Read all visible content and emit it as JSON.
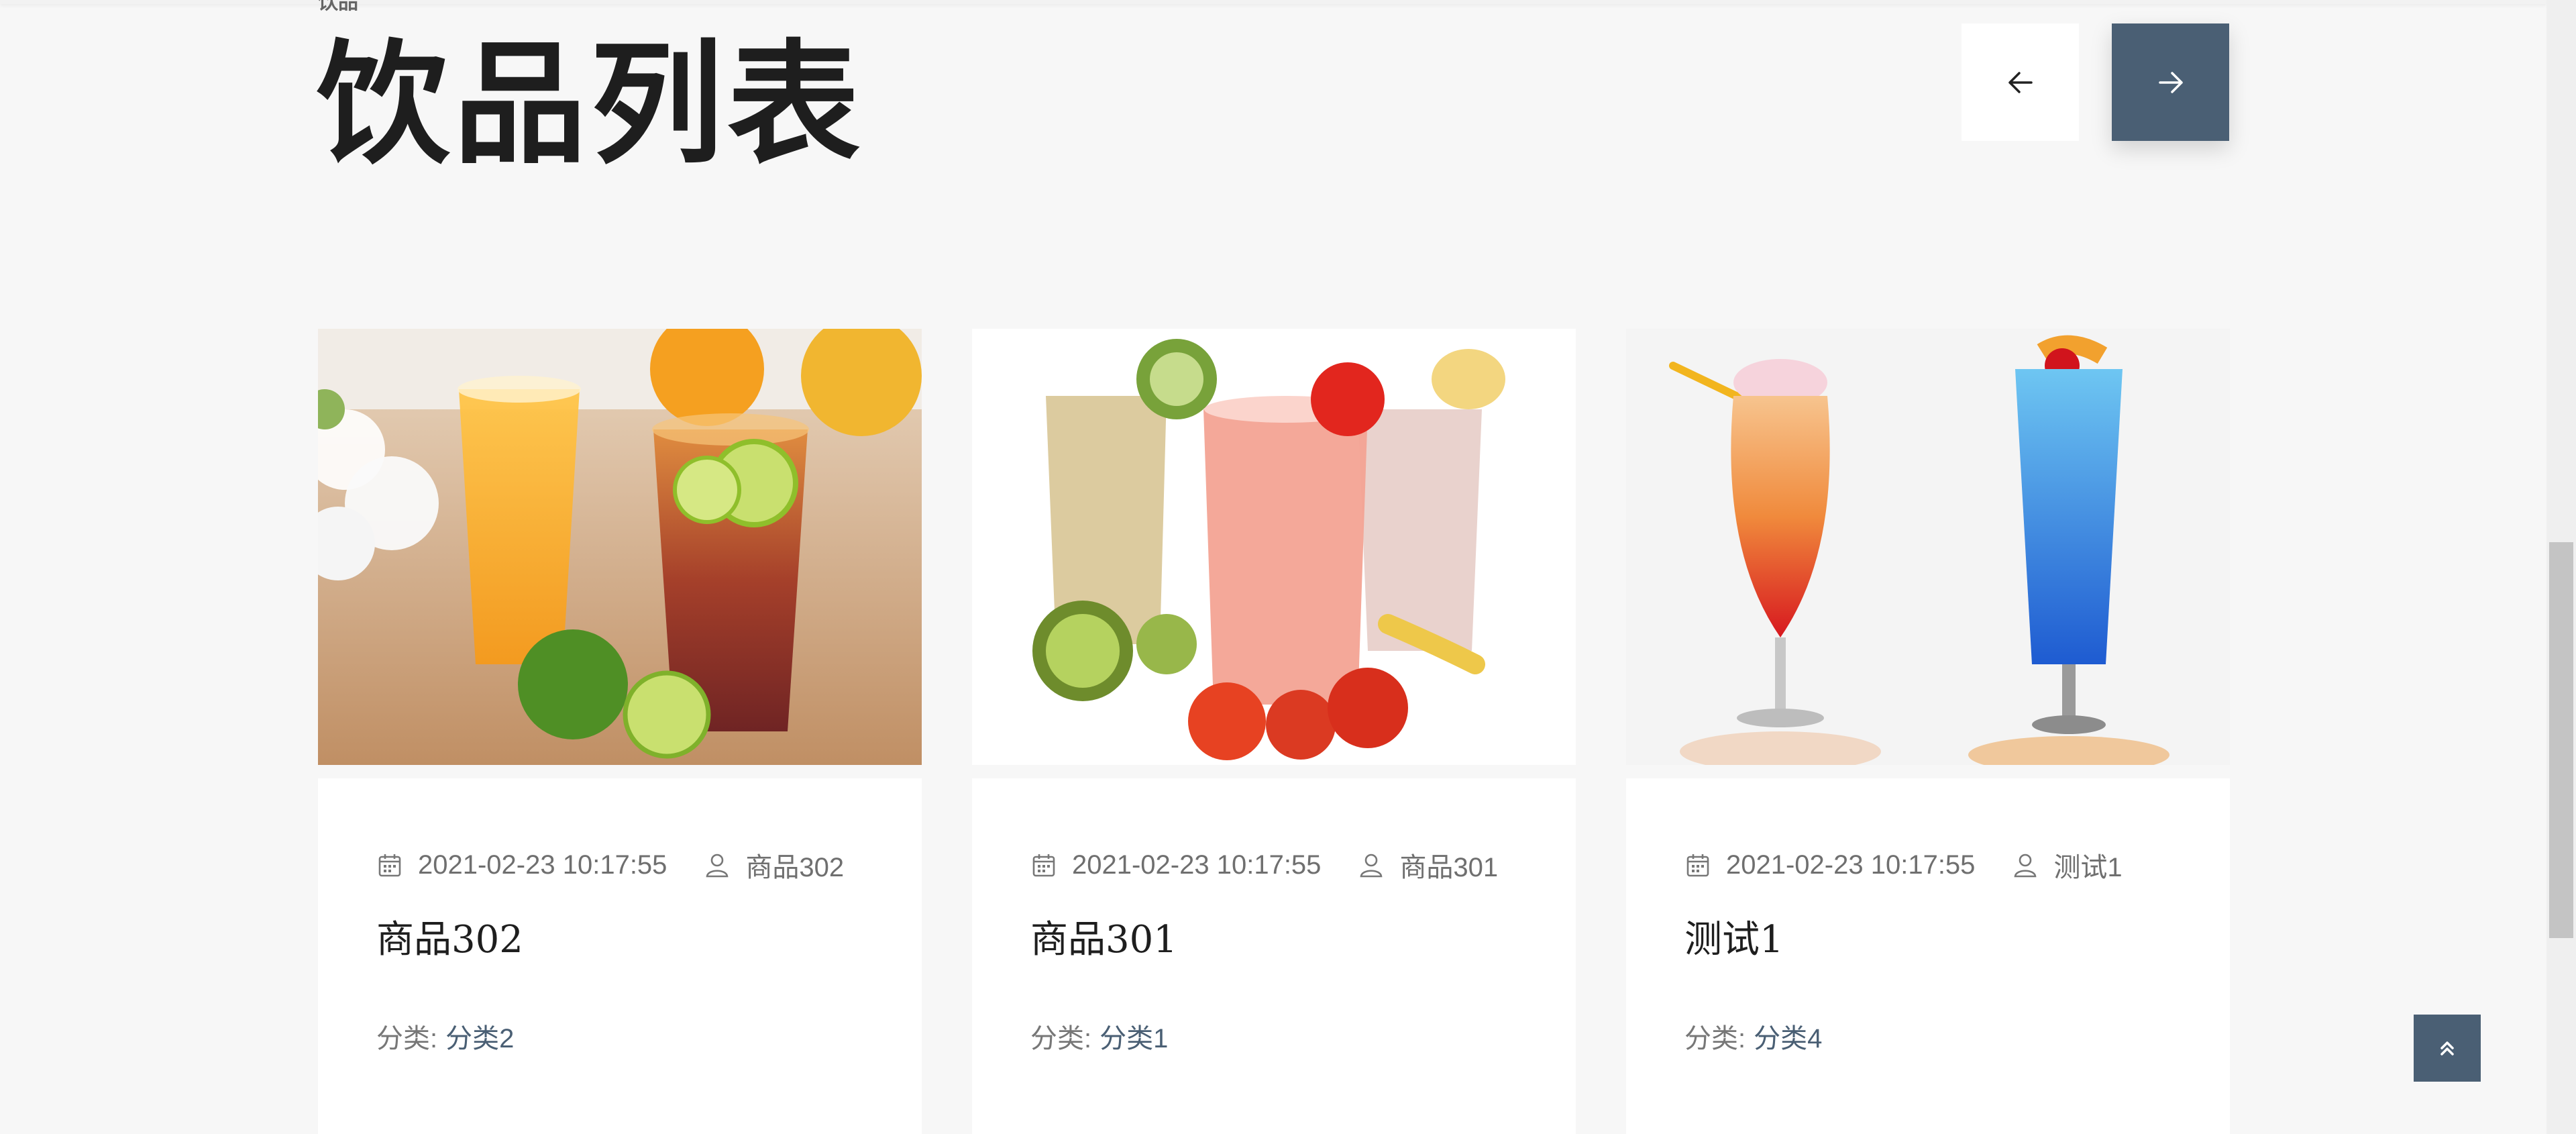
{
  "header": {
    "breadcrumb_remnant": "饮品",
    "title": "饮品列表"
  },
  "nav": {
    "prev_icon": "arrow-left-icon",
    "next_icon": "arrow-right-icon",
    "accent_color": "#4a5f74"
  },
  "cards": [
    {
      "image": "two-iced-drinks-orange-and-red-with-limes",
      "date": "2021-02-23 10:17:55",
      "author": "商品302",
      "title": "商品302",
      "category_label": "分类:",
      "category_value": "分类2"
    },
    {
      "image": "smoothies-kiwi-tomato-banana",
      "date": "2021-02-23 10:17:55",
      "author": "商品301",
      "title": "商品301",
      "category_label": "分类:",
      "category_value": "分类1"
    },
    {
      "image": "watercolor-cocktails-red-and-blue",
      "date": "2021-02-23 10:17:55",
      "author": "测试1",
      "title": "测试1",
      "category_label": "分类:",
      "category_value": "分类4"
    }
  ],
  "back_to_top_icon": "double-chevron-up-icon"
}
